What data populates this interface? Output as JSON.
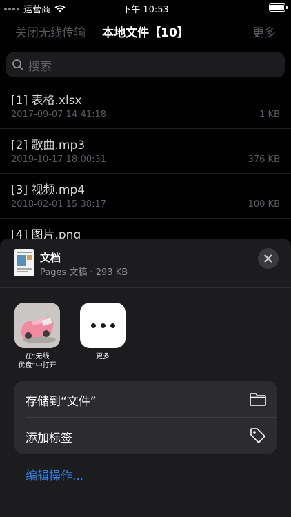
{
  "status_bar": {
    "carrier": "运营商",
    "time": "下午 10:53"
  },
  "nav": {
    "left": "关闭无线传输",
    "title": "本地文件【10】",
    "right": "更多"
  },
  "search": {
    "placeholder": "搜索"
  },
  "files": [
    {
      "name": "[1] 表格.xlsx",
      "date": "2017-09-07 14:41:18",
      "size": "1 KB"
    },
    {
      "name": "[2] 歌曲.mp3",
      "date": "2019-10-17 18:00:31",
      "size": "376 KB"
    },
    {
      "name": "[3] 视频.mp4",
      "date": "2018-02-01 15:38:17",
      "size": "100 KB"
    },
    {
      "name": "[4] 图片.png",
      "date": "",
      "size": ""
    }
  ],
  "share_sheet": {
    "doc_title": "文档",
    "doc_subtitle": "Pages 文稿 · 293 KB",
    "apps": [
      {
        "label_line1": "在“无线",
        "label_line2": "优盘”中打开"
      },
      {
        "label_line1": "更多",
        "label_line2": ""
      }
    ],
    "actions": [
      {
        "label": "存储到“文件”",
        "icon": "folder-icon"
      },
      {
        "label": "添加标签",
        "icon": "tag-icon"
      }
    ],
    "edit_actions": "编辑操作..."
  },
  "colors": {
    "background": "#000000",
    "sheet": "#1c1c1e",
    "accent_link": "#2f7fe0",
    "dim_text": "#5a5a5e"
  }
}
